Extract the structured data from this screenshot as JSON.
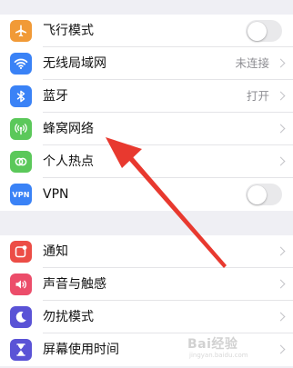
{
  "colors": {
    "airplane": "#f19a37",
    "wifi": "#3a82f6",
    "bluetooth": "#3a82f6",
    "cellular": "#5bc85a",
    "hotspot": "#5bc85a",
    "vpn": "#3a82f6",
    "notifications": "#ec4d46",
    "sounds": "#ec4d6a",
    "dnd": "#5a53d6",
    "screentime": "#5a53d6",
    "arrow": "#e8392f"
  },
  "group1": [
    {
      "label": "飞行模式",
      "icon": "airplane-icon",
      "toggle": "off"
    },
    {
      "label": "无线局域网",
      "value": "未连接",
      "icon": "wifi-icon"
    },
    {
      "label": "蓝牙",
      "value": "打开",
      "icon": "bluetooth-icon"
    },
    {
      "label": "蜂窝网络",
      "icon": "cellular-icon"
    },
    {
      "label": "个人热点",
      "icon": "hotspot-icon"
    },
    {
      "label": "VPN",
      "icon": "vpn-icon",
      "icon_text": "VPN",
      "toggle": "off"
    }
  ],
  "group2": [
    {
      "label": "通知",
      "icon": "notifications-icon"
    },
    {
      "label": "声音与触感",
      "icon": "speaker-icon"
    },
    {
      "label": "勿扰模式",
      "icon": "moon-icon"
    },
    {
      "label": "屏幕使用时间",
      "icon": "hourglass-icon"
    }
  ],
  "watermark": {
    "text": "Bai经验",
    "sub": "jingyan.baidu.com"
  }
}
